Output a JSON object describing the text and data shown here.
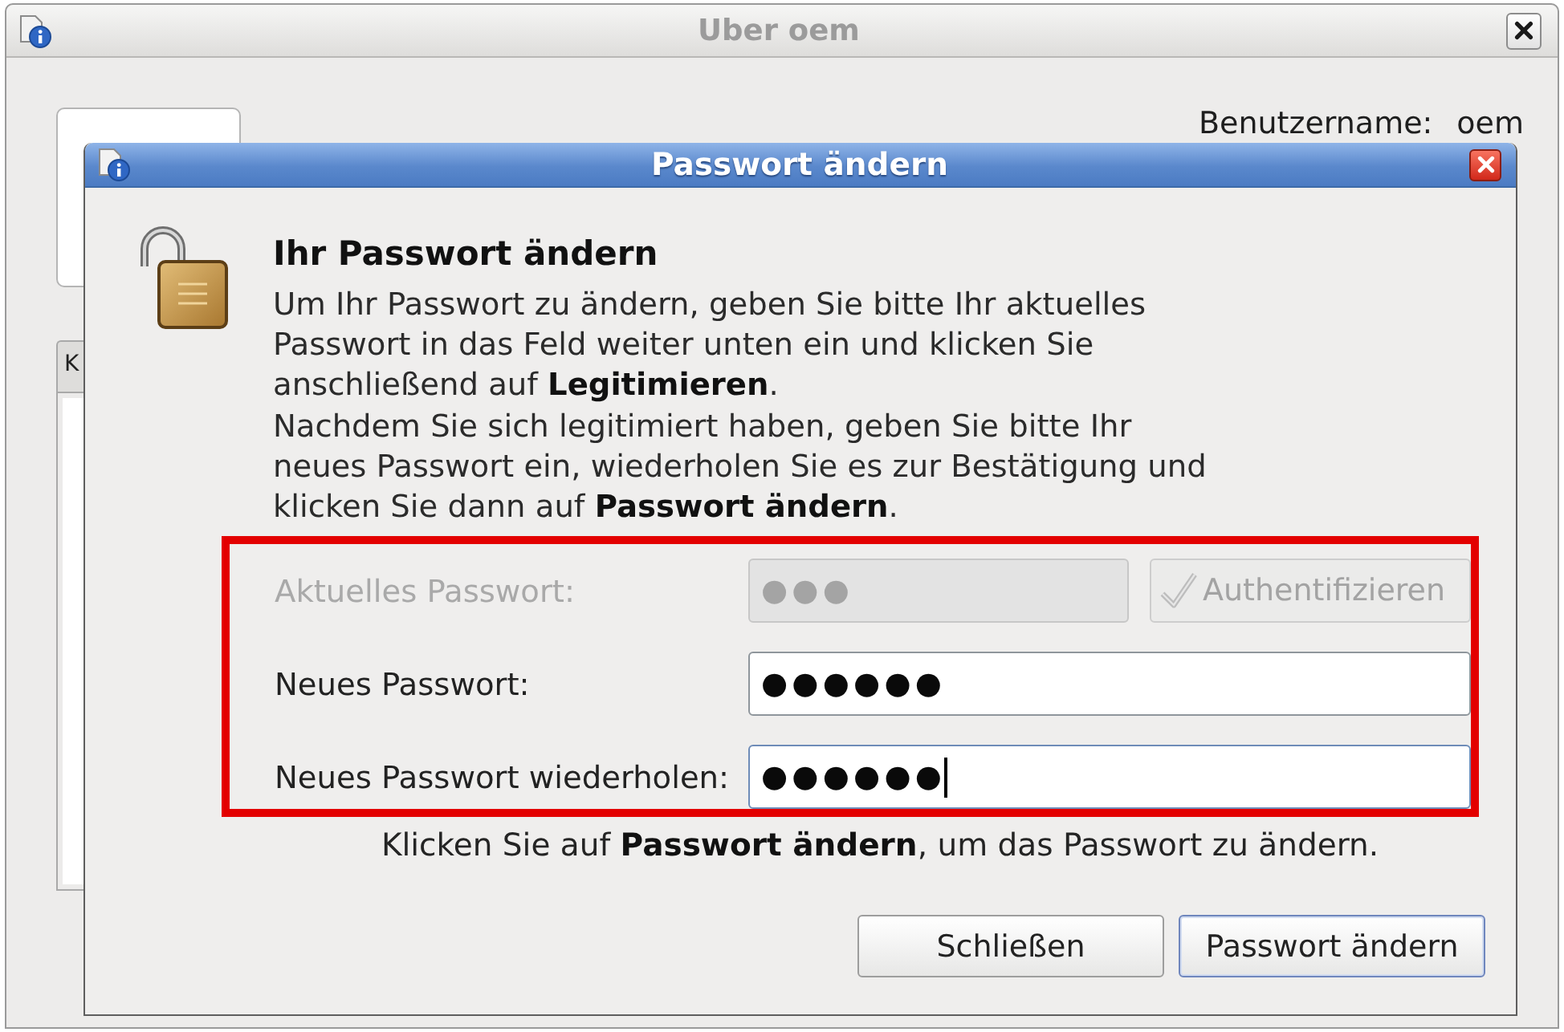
{
  "window": {
    "title": "Uber oem",
    "username_label": "Benutzername:",
    "username": "oem",
    "tabs": [
      {
        "label": "K",
        "selected": true
      }
    ]
  },
  "dialog": {
    "title": "Passwort ändern",
    "heading": "Ihr Passwort ändern",
    "description": "Um Ihr Passwort zu ändern, geben Sie bitte Ihr aktuelles\nPasswort in das Feld weiter unten ein und klicken Sie\nanschließend auf **Legitimieren**.\nNachdem Sie sich legitimiert haben, geben Sie bitte Ihr\nneues Passwort ein, wiederholen Sie es zur Bestätigung und\nklicken Sie dann auf **Passwort ändern**.",
    "fields": [
      {
        "label": "Aktuelles Passwort:",
        "value": "●●●",
        "disabled": true,
        "focused": false,
        "action": {
          "label": "Authentifizieren",
          "disabled": true
        }
      },
      {
        "label": "Neues Passwort:",
        "value": "●●●●●●",
        "disabled": false,
        "focused": false
      },
      {
        "label": "Neues Passwort wiederholen:",
        "value": "●●●●●●",
        "disabled": false,
        "focused": true
      }
    ],
    "hint": "Klicken Sie auf **Passwort ändern**, um das Passwort zu ändern.",
    "buttons": [
      {
        "label": "Schließen",
        "default": false
      },
      {
        "label": "Passwort ändern",
        "default": true
      }
    ]
  }
}
